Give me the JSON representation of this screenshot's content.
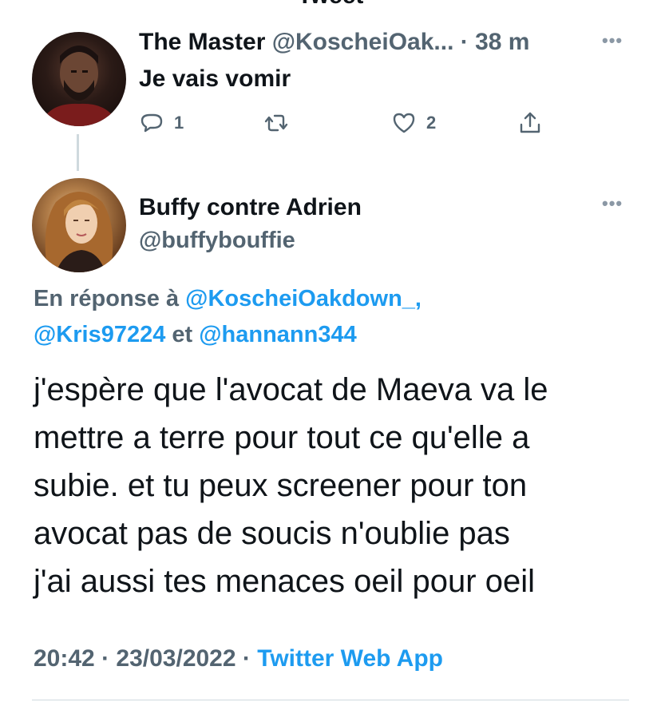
{
  "header": {
    "title": "Tweet"
  },
  "tweet1": {
    "name": "The Master",
    "handle": "@KoscheiOak...",
    "time_sep": " · ",
    "time": "38 m",
    "text": "Je vais vomir",
    "reply_count": "1",
    "like_count": "2"
  },
  "tweet2": {
    "name": "Buffy contre Adrien",
    "handle": "@buffybouffie",
    "reply_prefix": "En réponse à ",
    "reply_mention1": "@KoscheiOakdown_,",
    "reply_mention2": "@Kris97224",
    "reply_and": " et ",
    "reply_mention3": "@hannann344",
    "text_lines": [
      "j'espère que l'avocat de Maeva va le",
      "mettre a terre pour tout ce qu'elle a",
      "subie. et tu peux screener pour ton",
      "avocat pas de soucis n'oublie pas",
      "j'ai aussi tes menaces oeil pour oeil"
    ],
    "time": "20:42",
    "date": "23/03/2022",
    "sep": " · ",
    "app": "Twitter Web App"
  },
  "icons": [
    "back-arrow-icon",
    "reply-icon",
    "retweet-icon",
    "like-icon",
    "share-icon",
    "more-icon"
  ],
  "colors": {
    "accent": "#1d9bf0",
    "secondary_text": "#536471",
    "primary_text": "#0f1419"
  }
}
